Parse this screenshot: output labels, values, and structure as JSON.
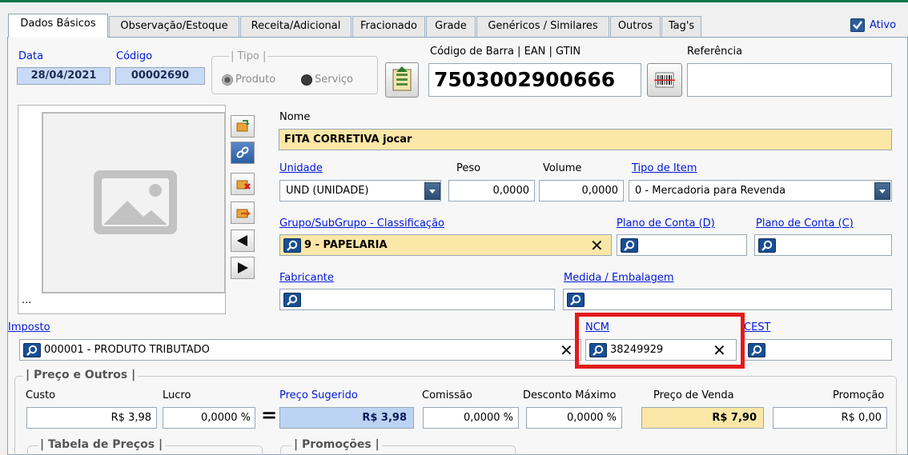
{
  "tabs": [
    {
      "label": "Dados Básicos",
      "active": true
    },
    {
      "label": "Observação/Estoque"
    },
    {
      "label": "Receita/Adicional"
    },
    {
      "label": "Fracionado"
    },
    {
      "label": "Grade"
    },
    {
      "label": "Genéricos / Similares"
    },
    {
      "label": "Outros"
    },
    {
      "label": "Tag's"
    }
  ],
  "ativo": {
    "label": "Ativo",
    "checked": true
  },
  "header": {
    "data_label": "Data",
    "data_value": "28/04/2021",
    "codigo_label": "Código",
    "codigo_value": "00002690",
    "tipo_label": "| Tipo |",
    "tipo_options": [
      "Produto",
      "Serviço"
    ],
    "barcode_label": "Código de Barra | EAN | GTIN",
    "barcode_value": "7503002900666",
    "referencia_label": "Referência",
    "referencia_value": ""
  },
  "image_panel": {
    "dots": "..."
  },
  "produto": {
    "nome_label": "Nome",
    "nome_value": "FITA CORRETIVA jocar",
    "unidade_label": "Unidade",
    "unidade_value": "UND (UNIDADE)",
    "peso_label": "Peso",
    "peso_value": "0,0000",
    "volume_label": "Volume",
    "volume_value": "0,0000",
    "tipo_item_label": "Tipo de Item",
    "tipo_item_value": "0 - Mercadoria para Revenda",
    "grupo_label": "Grupo/SubGrupo - Classificação",
    "grupo_value": "9 - PAPELARIA",
    "plano_d_label": "Plano de Conta (D)",
    "plano_c_label": "Plano de Conta (C)",
    "fabricante_label": "Fabricante",
    "medida_label": "Medida / Embalagem",
    "imposto_label": "Imposto",
    "imposto_value": "000001 - PRODUTO TRIBUTADO",
    "ncm_label": "NCM",
    "ncm_value": "38249929",
    "cest_label": "CEST",
    "highlight_color": "#e11b1b"
  },
  "preco": {
    "group_label": "| Preço e Outros |",
    "custo_label": "Custo",
    "custo_value": "R$ 3,98",
    "lucro_label": "Lucro",
    "lucro_value": "0,0000 %",
    "equals": "=",
    "sugerido_label": "Preço Sugerido",
    "sugerido_value": "R$ 3,98",
    "comissao_label": "Comissão",
    "comissao_value": "0,0000 %",
    "desconto_label": "Desconto Máximo",
    "desconto_value": "0,0000 %",
    "venda_label": "Preço de Venda",
    "venda_value": "R$ 7,90",
    "promocao_label": "Promoção",
    "promocao_value": "R$ 0,00",
    "tabela_label": "| Tabela de Preços |",
    "promocoes_label": "| Promoções |"
  }
}
